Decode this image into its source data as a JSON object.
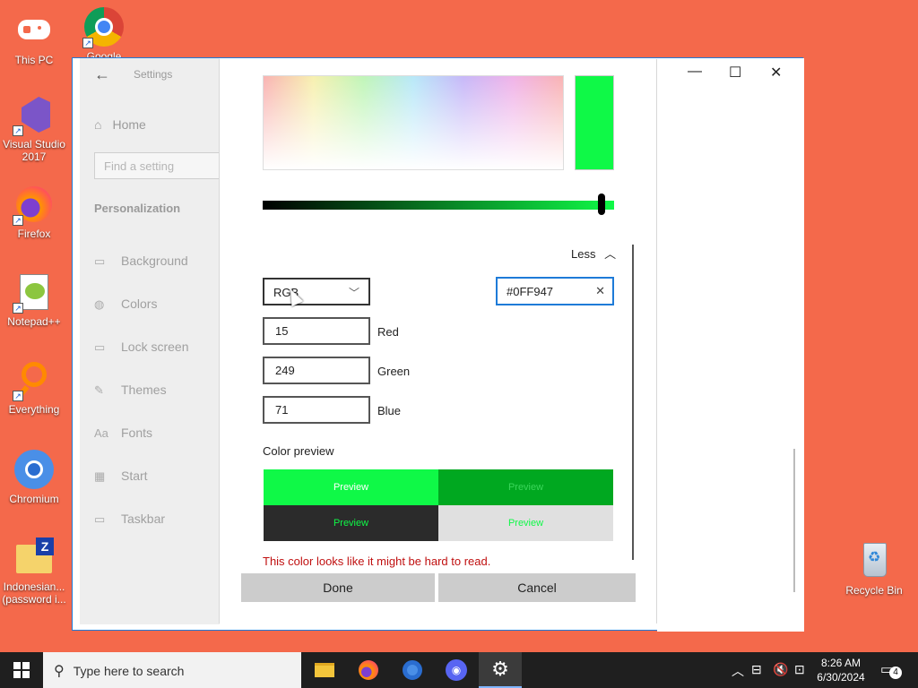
{
  "desktop": {
    "icons": [
      {
        "label": "This PC"
      },
      {
        "label": "Google Chrome"
      },
      {
        "label": "Visual Studio 2017"
      },
      {
        "label": "Firefox"
      },
      {
        "label": "Notepad++"
      },
      {
        "label": "Everything"
      },
      {
        "label": "Chromium"
      },
      {
        "label": "Indonesian... (password i..."
      },
      {
        "label": "Recycle Bin"
      }
    ]
  },
  "settings": {
    "title": "Settings",
    "home": "Home",
    "search_placeholder": "Find a setting",
    "section": "Personalization",
    "nav": [
      {
        "label": "Background",
        "icon": "image-icon"
      },
      {
        "label": "Colors",
        "icon": "palette-icon"
      },
      {
        "label": "Lock screen",
        "icon": "lock-screen-icon"
      },
      {
        "label": "Themes",
        "icon": "brush-icon"
      },
      {
        "label": "Fonts",
        "icon": "font-icon"
      },
      {
        "label": "Start",
        "icon": "start-icon"
      },
      {
        "label": "Taskbar",
        "icon": "taskbar-icon"
      }
    ]
  },
  "color_dialog": {
    "selected_color": "#0ff947",
    "less_label": "Less",
    "mode_value": "RGB",
    "hex_value": "#0FF947",
    "red_value": "15",
    "red_label": "Red",
    "green_value": "249",
    "green_label": "Green",
    "blue_value": "71",
    "blue_label": "Blue",
    "preview_title": "Color preview",
    "preview_text": "Preview",
    "preview_colors": {
      "top_left_bg": "#0ff947",
      "top_left_fg": "#ffffff",
      "top_right_bg": "#00a820",
      "top_right_fg": "#3ad65a",
      "bottom_left_bg": "#2b2b2b",
      "bottom_left_fg": "#0ff947",
      "bottom_right_bg": "#e0e0e0",
      "bottom_right_fg": "#0ff947"
    },
    "warning": "This color looks like it might be hard to read.",
    "done_label": "Done",
    "cancel_label": "Cancel"
  },
  "taskbar": {
    "search_placeholder": "Type here to search",
    "apps": [
      "file-explorer-icon",
      "firefox-icon",
      "chromium-icon",
      "discord-icon",
      "settings-icon"
    ],
    "time": "8:26 AM",
    "date": "6/30/2024",
    "notification_count": "4"
  }
}
